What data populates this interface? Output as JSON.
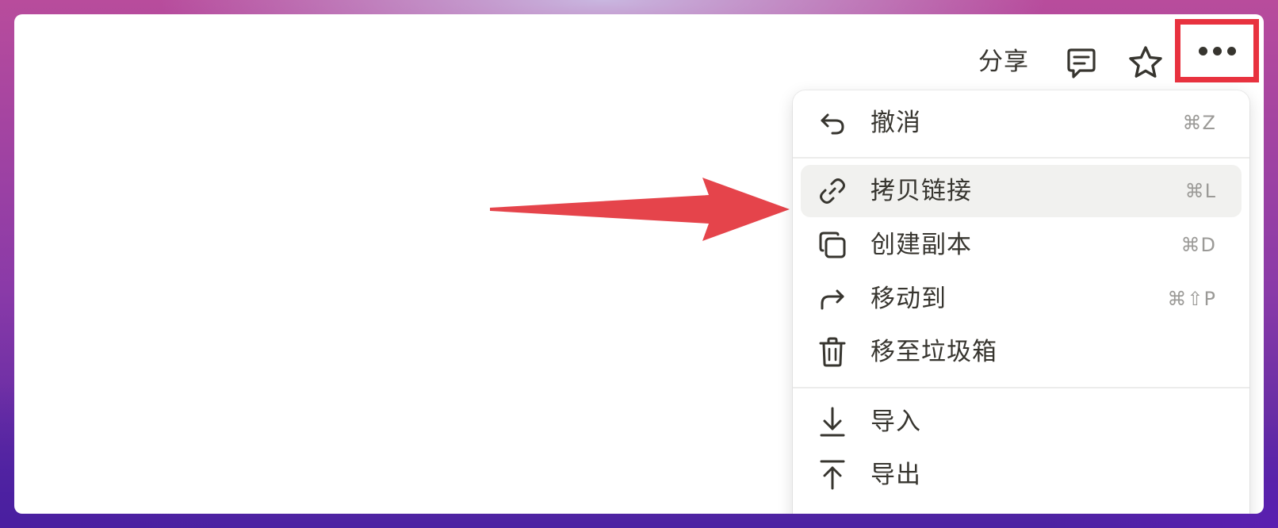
{
  "toolbar": {
    "share_label": "分享",
    "comment_icon": "comment-icon",
    "star_icon": "star-icon",
    "more_icon": "more-horizontal-icon"
  },
  "menu": {
    "items": [
      {
        "icon": "undo-icon",
        "label": "撤消",
        "shortcut": "⌘Z"
      },
      {
        "icon": "link-icon",
        "label": "拷贝链接",
        "shortcut": "⌘L"
      },
      {
        "icon": "duplicate-icon",
        "label": "创建副本",
        "shortcut": "⌘D"
      },
      {
        "icon": "move-to-icon",
        "label": "移动到",
        "shortcut": "⌘⇧P"
      },
      {
        "icon": "trash-icon",
        "label": "移至垃圾箱",
        "shortcut": ""
      },
      {
        "icon": "import-icon",
        "label": "导入",
        "shortcut": ""
      },
      {
        "icon": "export-icon",
        "label": "导出",
        "shortcut": ""
      }
    ],
    "highlighted_item": "拷贝链接"
  },
  "colors": {
    "highlight_red": "#e8323f",
    "text": "#37352f",
    "muted": "#9b9a97",
    "hover_bg": "#f1f1ef"
  }
}
